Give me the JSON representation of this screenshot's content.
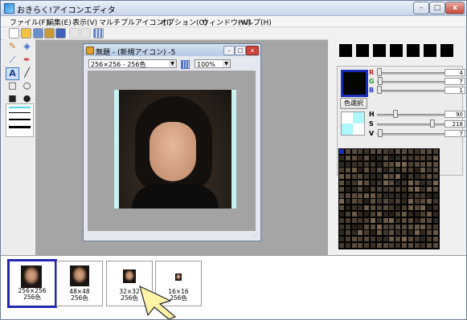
{
  "window": {
    "title": "おきらく!アイコンエディタ",
    "buttons": {
      "minimize": "–",
      "maximize": "□",
      "close": "x"
    }
  },
  "menu": [
    "ファイル(F)",
    "編集(E)",
    "表示(V)",
    "マルチプルアイコン(I)",
    "オプション(O)",
    "ウィンドウ(W)",
    "ヘルプ(H)"
  ],
  "toolbar": {
    "icons": [
      "new-icon",
      "open-icon",
      "save-icon",
      "save-all-icon",
      "disk-icon",
      "undo-icon",
      "redo-icon",
      "grid-icon"
    ]
  },
  "tools": [
    "pencil-icon",
    "fill-bucket-icon",
    "eyedropper-icon",
    "pen-icon",
    "text-icon",
    "line-icon",
    "rectangle-icon",
    "ellipse-icon",
    "filled-rectangle-icon",
    "filled-ellipse-icon"
  ],
  "document": {
    "title": "無題 - (新規アイコン) -5",
    "format_select": "256×256 - 256色",
    "zoom_select": "100%"
  },
  "color_panel": {
    "rgb": [
      {
        "label": "R",
        "value": "4",
        "level": 0.02
      },
      {
        "label": "G",
        "value": "7",
        "level": 0.03
      },
      {
        "label": "B",
        "value": "1",
        "level": 0.0
      }
    ],
    "pick_button": "色選択",
    "hsv": [
      {
        "label": "H",
        "value": "90",
        "level": 0.25
      },
      {
        "label": "S",
        "value": "218",
        "level": 0.85
      },
      {
        "label": "V",
        "value": "7",
        "level": 0.03
      }
    ],
    "current_color": "#040701",
    "primary_color": "#000000",
    "secondary_color": "#aef7fa"
  },
  "icons_list": [
    {
      "size": "256×256",
      "colors": "256色",
      "selected": true
    },
    {
      "size": "48×48",
      "colors": "256色",
      "selected": false
    },
    {
      "size": "32×32",
      "colors": "256色",
      "selected": false
    },
    {
      "size": "16×16",
      "colors": "256色",
      "selected": false
    }
  ]
}
